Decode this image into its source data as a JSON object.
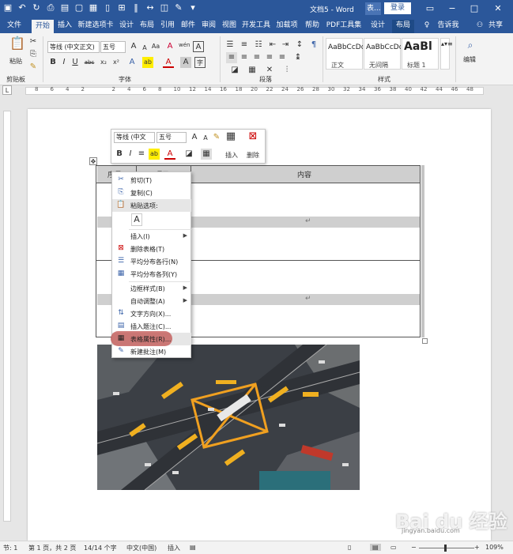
{
  "window": {
    "title": "文档5 - Word",
    "search_short": "表...",
    "login": "登录",
    "min": "−",
    "restore": "□",
    "close": "✕",
    "ribbon_opt": "▭"
  },
  "tabs": [
    "文件",
    "开始",
    "插入",
    "新建选项卡",
    "设计",
    "布局",
    "引用",
    "邮件",
    "审阅",
    "视图",
    "开发工具",
    "加载项",
    "帮助",
    "PDF工具集",
    "设计",
    "布局"
  ],
  "tell_me": "告诉我",
  "share": "共享",
  "ribbon": {
    "paste": "粘贴",
    "clipboard": "剪贴板",
    "font_name": "等线 (中文正文)",
    "font_size": "五号",
    "font_group": "字体",
    "paragraph_group": "段落",
    "styles_group": "样式",
    "styles": [
      {
        "preview": "AaBbCcDd",
        "name": "正文"
      },
      {
        "preview": "AaBbCcDd",
        "name": "无间隔"
      },
      {
        "preview": "AaBl",
        "name": "标题 1"
      }
    ],
    "editing": "编辑",
    "bold": "B",
    "italic": "I",
    "underline": "U",
    "strike": "abc",
    "sub": "x₂",
    "sup": "x²",
    "grow": "A",
    "shrink": "A",
    "case": "Aa",
    "clear": "A",
    "font_color": "A",
    "highlight": "ab",
    "phonetic": "wén",
    "border_char": "A"
  },
  "ruler_nums": [
    "8",
    "6",
    "4",
    "2",
    "",
    "2",
    "4",
    "6",
    "8",
    "10",
    "12",
    "14",
    "16",
    "18",
    "20",
    "22",
    "24",
    "26",
    "28",
    "30",
    "32",
    "34",
    "36",
    "38",
    "40",
    "42",
    "44",
    "46",
    "48"
  ],
  "mini_toolbar": {
    "font": "等线 (中文",
    "size": "五号",
    "insert": "插入",
    "delete": "删除",
    "bold": "B",
    "italic": "I"
  },
  "table": {
    "headers": [
      "序号",
      "项目",
      "内容"
    ],
    "para_mark": "↵"
  },
  "context_menu": [
    {
      "label": "剪切(T)",
      "icon": "✂",
      "type": "item"
    },
    {
      "label": "复制(C)",
      "icon": "⎘",
      "type": "item"
    },
    {
      "label": "粘贴选项:",
      "icon": "📋",
      "type": "header"
    },
    {
      "label": "插入(I)",
      "icon": "",
      "type": "sub"
    },
    {
      "label": "删除表格(T)",
      "icon": "⊠",
      "type": "item"
    },
    {
      "label": "平均分布各行(N)",
      "icon": "☰",
      "type": "item"
    },
    {
      "label": "平均分布各列(Y)",
      "icon": "▦",
      "type": "item"
    },
    {
      "label": "边框样式(B)",
      "icon": "",
      "type": "sub"
    },
    {
      "label": "自动调整(A)",
      "icon": "",
      "type": "sub"
    },
    {
      "label": "文字方向(X)...",
      "icon": "⇅",
      "type": "item"
    },
    {
      "label": "插入题注(C)...",
      "icon": "▤",
      "type": "item"
    },
    {
      "label": "表格属性(R)...",
      "icon": "▦",
      "type": "item",
      "highlighted": true
    },
    {
      "label": "新建批注(M)",
      "icon": "✎",
      "type": "item"
    }
  ],
  "status": {
    "section": "节: 1",
    "page": "第 1 页，共 2 页",
    "words": "14/14 个字",
    "lang": "中文(中国)",
    "mode": "插入",
    "zoom": "109%"
  },
  "watermark": {
    "text": "Bai du 经验",
    "sub": "jingyan.baidu.com"
  },
  "colors": {
    "accent": "#2b579a",
    "menu_highlight": "#c0504d"
  }
}
